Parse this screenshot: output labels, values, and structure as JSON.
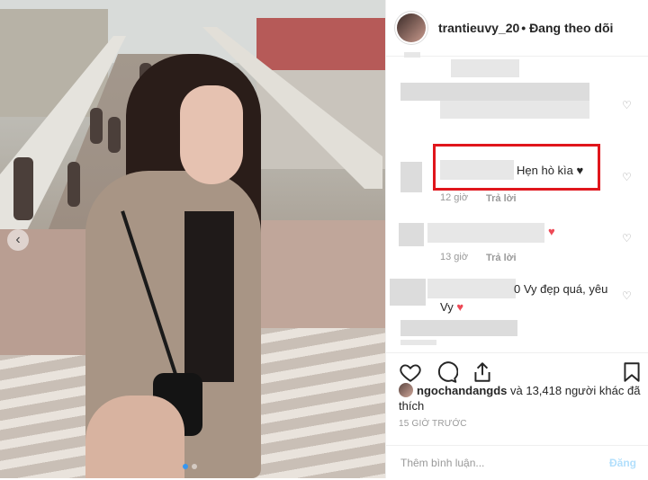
{
  "post": {
    "username": "trantieuvy_20",
    "follow_status": "• Đang theo dõi"
  },
  "comments": [
    {
      "text": "",
      "time": "",
      "reply": ""
    },
    {
      "text": "Hẹn hò kìa",
      "emoji": "♥",
      "time": "12 giờ",
      "reply": "Trả lời"
    },
    {
      "text": "",
      "emoji": "♥",
      "time": "13 giờ",
      "reply": "Trả lời"
    },
    {
      "text_line1": "0 Vy đẹp quá, yêu",
      "text_line2": "Vy",
      "emoji": "♥"
    }
  ],
  "actions": {
    "likes_user": "ngochandangds",
    "likes_rest": " và 13,418 người khác đã thích",
    "timestamp": "15 GIỜ TRƯỚC"
  },
  "add_comment": {
    "placeholder": "Thêm bình luận...",
    "post_label": "Đăng"
  },
  "colors": {
    "highlight_box": "#e0161c",
    "heart": "#ed4956",
    "dot_active": "#3897f0"
  },
  "icons": [
    "heart-outline-icon",
    "comment-icon",
    "share-icon",
    "bookmark-icon",
    "chevron-left-icon"
  ]
}
